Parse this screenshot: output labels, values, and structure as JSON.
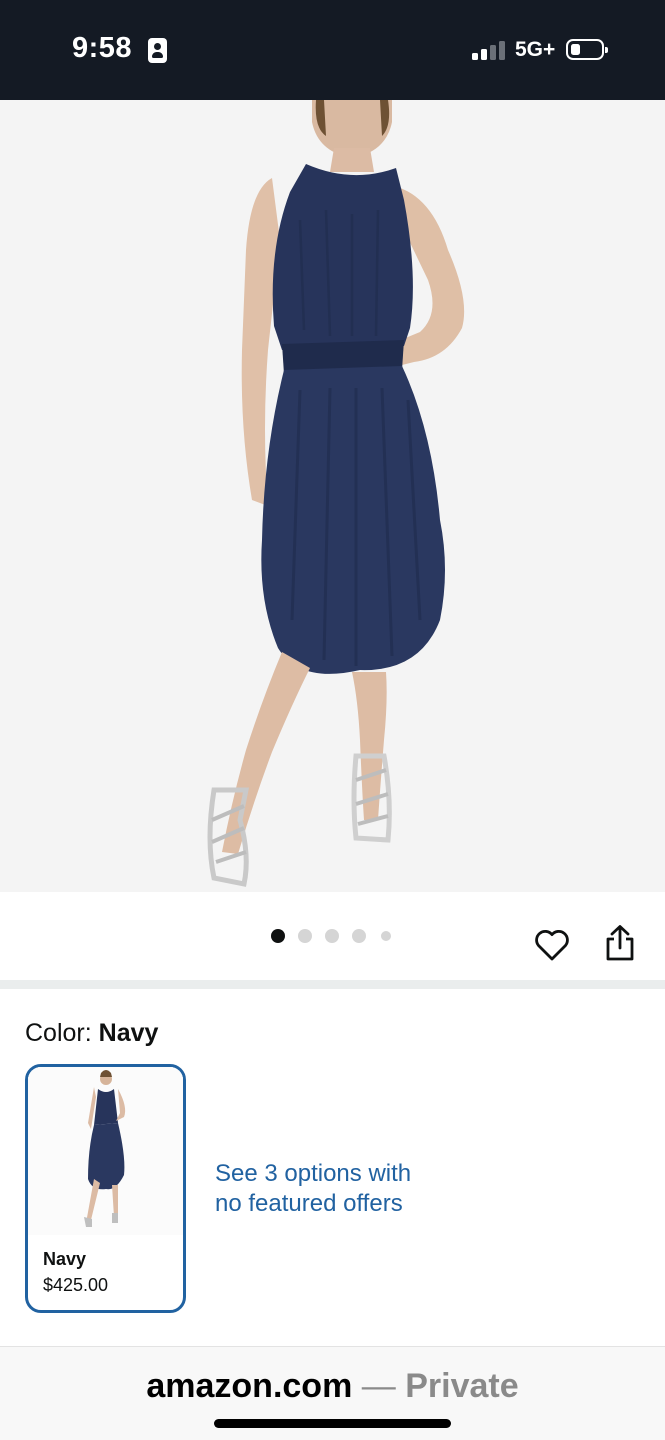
{
  "status_bar": {
    "time": "9:58",
    "network": "5G+",
    "signal_bars_active": 2,
    "signal_bars_total": 4,
    "battery_level": 0.2
  },
  "product": {
    "image_icon": "product-photo-navy-dress",
    "carousel": {
      "count": 5,
      "active_index": 0
    },
    "actions": {
      "wishlist_icon": "heart-icon",
      "share_icon": "share-icon"
    }
  },
  "color": {
    "label": "Color:",
    "selected": "Navy"
  },
  "swatch": {
    "name": "Navy",
    "price": "$425.00",
    "image_icon": "navy-dress-thumbnail"
  },
  "options_link": {
    "line1": "See 3 options with",
    "line2": "no featured offers"
  },
  "browser": {
    "host": "amazon.com",
    "separator": " — ",
    "mode": "Private"
  },
  "colors": {
    "status_bg": "#141a24",
    "link": "#2162a1",
    "dress": "#25335a",
    "image_bg": "#f4f4f4"
  }
}
